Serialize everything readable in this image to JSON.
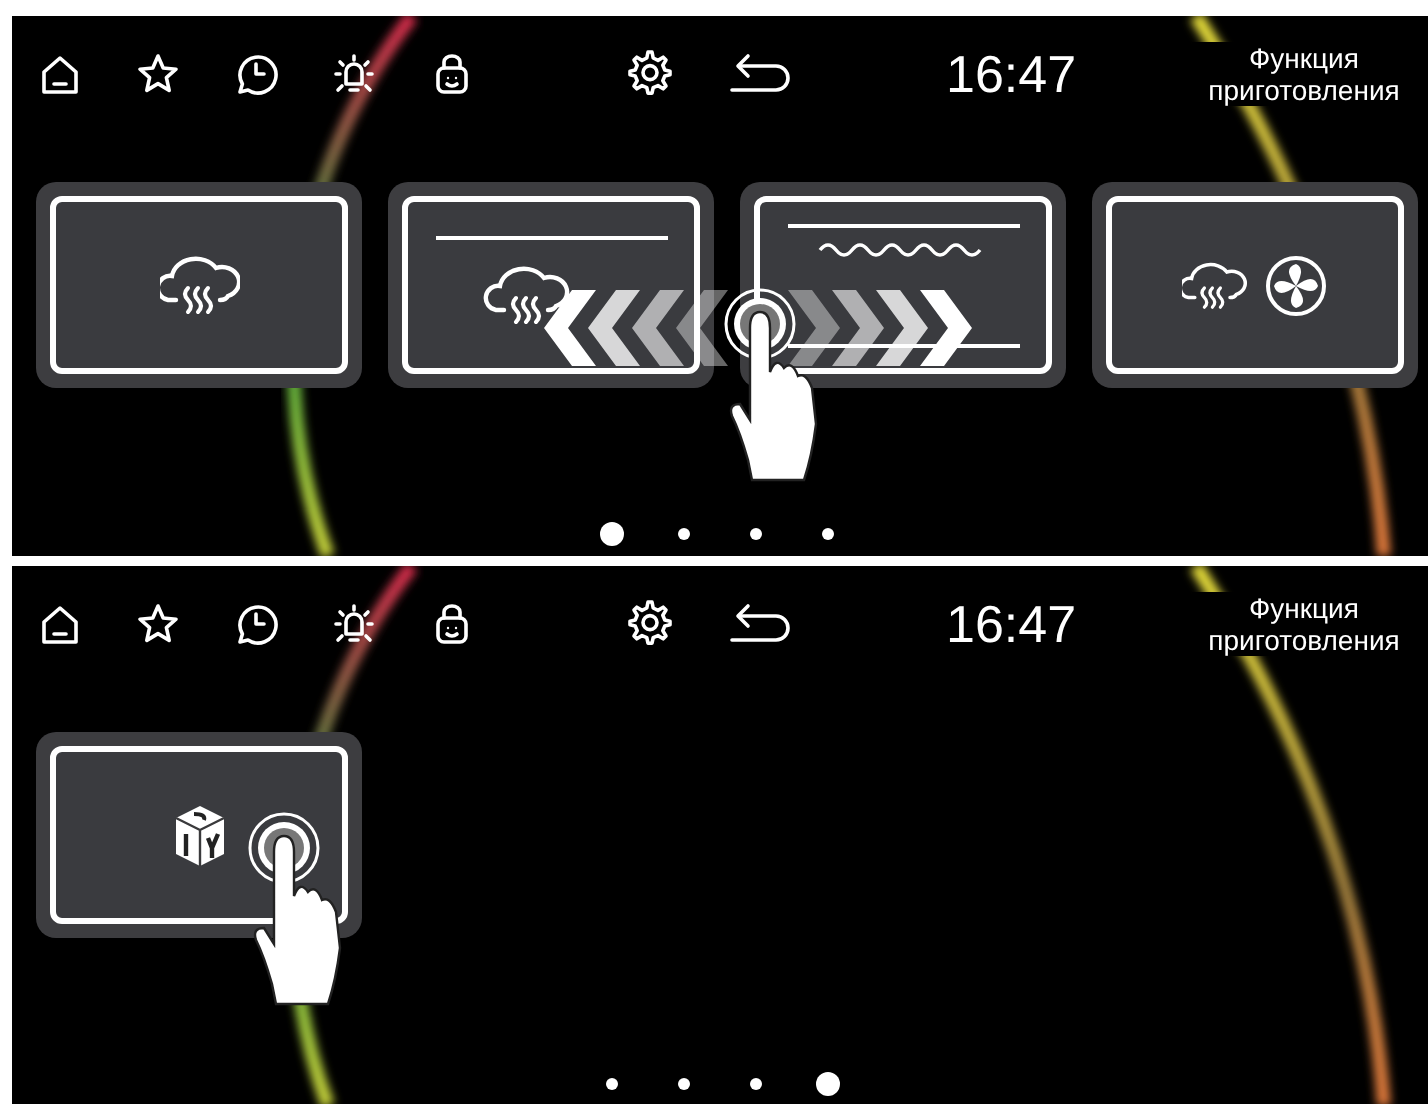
{
  "screens": [
    {
      "time": "16:47",
      "title": "Функция приготовления",
      "gesture": {
        "kind": "swipe"
      },
      "cards": [
        {
          "kind": "steam"
        },
        {
          "kind": "top-steam"
        },
        {
          "kind": "grill"
        },
        {
          "kind": "steam-fan"
        }
      ],
      "page_dots": [
        {
          "selected": true
        },
        {
          "selected": false
        },
        {
          "selected": false
        },
        {
          "selected": false
        }
      ]
    },
    {
      "time": "16:47",
      "title": "Функция приготовления",
      "gesture": {
        "kind": "tap"
      },
      "cards": [
        {
          "kind": "diy"
        }
      ],
      "page_dots": [
        {
          "selected": false
        },
        {
          "selected": false
        },
        {
          "selected": false
        },
        {
          "selected": true
        }
      ]
    }
  ]
}
